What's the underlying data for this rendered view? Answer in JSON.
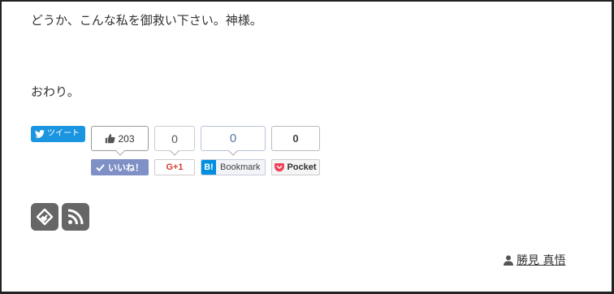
{
  "body": {
    "paragraph_1": "どうか、こんな私を御救い下さい。神様。",
    "paragraph_2": "おわり。"
  },
  "share": {
    "tweet_label": "ツイート",
    "like": {
      "count": "203",
      "button_label": "いいね！"
    },
    "google_plus": {
      "count": "0",
      "button_label": "G+1"
    },
    "hatena": {
      "count": "0",
      "icon_letter": "B!",
      "button_label": "Bookmark"
    },
    "pocket": {
      "count": "0",
      "button_label": "Pocket"
    }
  },
  "follow": {
    "icons": [
      "feedly-icon",
      "rss-icon"
    ]
  },
  "author": {
    "name": "勝見 真悟"
  },
  "colors": {
    "twitter": "#1b95e0",
    "facebook_like": "#7e90c6",
    "hatena": "#008fde",
    "pocket": "#ef4056",
    "feed_icon_bg": "#666666"
  }
}
